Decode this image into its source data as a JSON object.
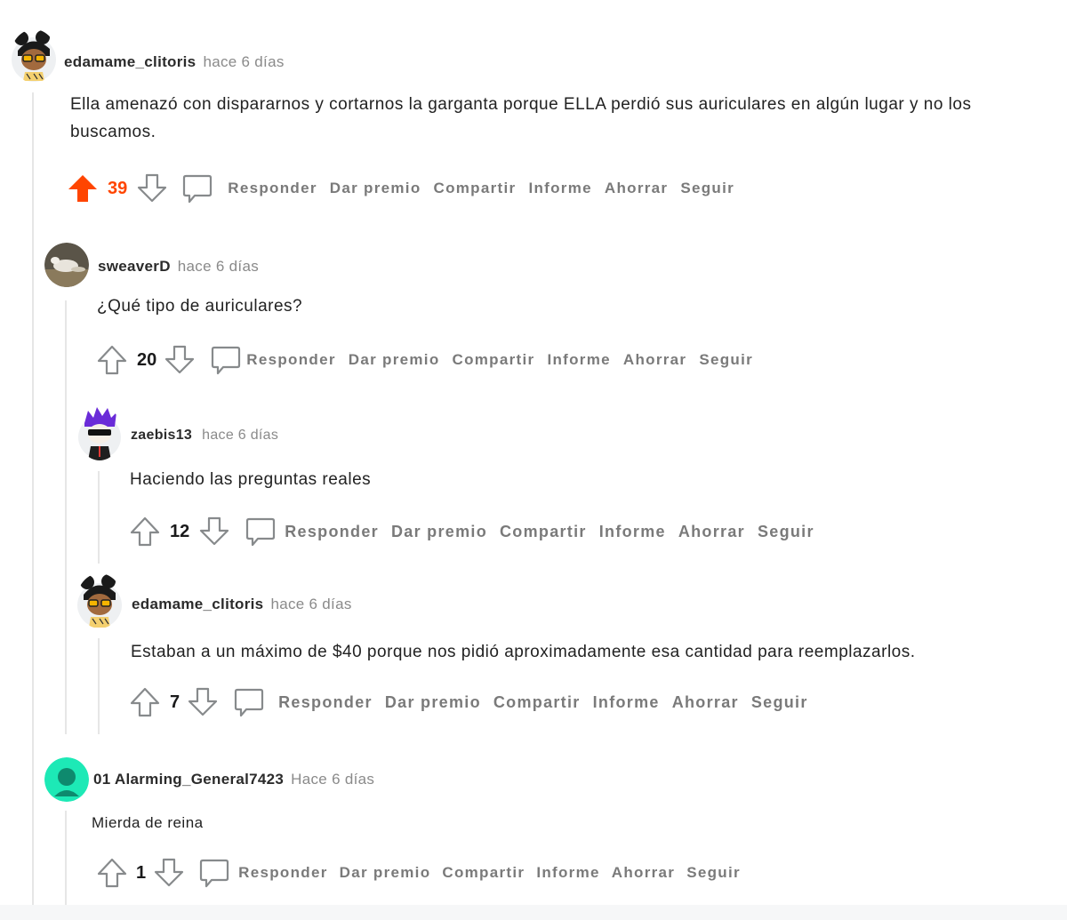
{
  "comments": [
    {
      "username": "edamame_clitoris",
      "time": "hace 6 días",
      "body": "Ella amenazó con dispararnos y cortarnos la garganta porque ELLA perdió sus auriculares en algún lugar y no los buscamos.",
      "score": "39",
      "upvoted": true
    },
    {
      "username": "sweaverD",
      "time": "hace 6 días",
      "body": "¿Qué tipo de auriculares?",
      "score": "20",
      "upvoted": false
    },
    {
      "username": "zaebis13",
      "time": "hace 6 días",
      "body": "Haciendo las preguntas reales",
      "score": "12",
      "upvoted": false
    },
    {
      "username": "edamame_clitoris",
      "time": "hace 6 días",
      "body": "Estaban a un máximo de $40 porque nos pidió aproximadamente esa cantidad para reemplazarlos.",
      "score": "7",
      "upvoted": false
    },
    {
      "username": "01 Alarming_General7423",
      "time": "Hace 6 días",
      "body": "Mierda de reina",
      "score": "1",
      "upvoted": false
    }
  ],
  "actions": {
    "reply": "Responder",
    "award": "Dar premio",
    "share": "Compartir",
    "report": "Informe",
    "save": "Ahorrar",
    "follow": "Seguir"
  },
  "colors": {
    "upvote_active": "#ff4500",
    "action_text": "#7a7a7a",
    "thread_line": "#e6e6e6",
    "teal_avatar": "#1de9b6"
  },
  "icons": [
    "upvote-icon",
    "downvote-icon",
    "comment-bubble-icon"
  ]
}
